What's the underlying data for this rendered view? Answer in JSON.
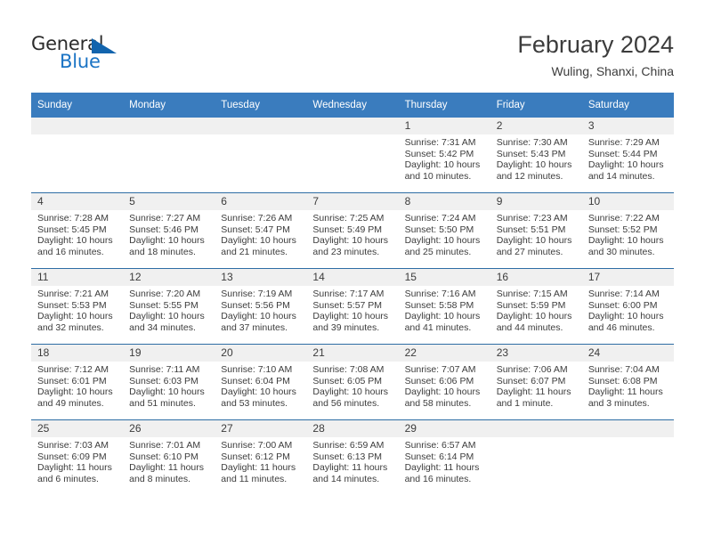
{
  "logo": {
    "text_top": "General",
    "text_bottom": "Blue",
    "triangle_icon": "triangle-icon",
    "color_dark": "#2b2b2b",
    "color_blue": "#1a73c4"
  },
  "header": {
    "title": "February 2024",
    "subtitle": "Wuling, Shanxi, China"
  },
  "theme": {
    "header_blue": "#3a7cbe",
    "rule_blue": "#2e6da4",
    "day_band_gray": "#f0f0f0",
    "text": "#3c3c3c"
  },
  "calendar": {
    "weekday_headers": [
      "Sunday",
      "Monday",
      "Tuesday",
      "Wednesday",
      "Thursday",
      "Friday",
      "Saturday"
    ],
    "weeks": [
      [
        {
          "day": "",
          "sunrise": "",
          "sunset": "",
          "daylight_1": "",
          "daylight_2": ""
        },
        {
          "day": "",
          "sunrise": "",
          "sunset": "",
          "daylight_1": "",
          "daylight_2": ""
        },
        {
          "day": "",
          "sunrise": "",
          "sunset": "",
          "daylight_1": "",
          "daylight_2": ""
        },
        {
          "day": "",
          "sunrise": "",
          "sunset": "",
          "daylight_1": "",
          "daylight_2": ""
        },
        {
          "day": "1",
          "sunrise": "Sunrise: 7:31 AM",
          "sunset": "Sunset: 5:42 PM",
          "daylight_1": "Daylight: 10 hours",
          "daylight_2": "and 10 minutes."
        },
        {
          "day": "2",
          "sunrise": "Sunrise: 7:30 AM",
          "sunset": "Sunset: 5:43 PM",
          "daylight_1": "Daylight: 10 hours",
          "daylight_2": "and 12 minutes."
        },
        {
          "day": "3",
          "sunrise": "Sunrise: 7:29 AM",
          "sunset": "Sunset: 5:44 PM",
          "daylight_1": "Daylight: 10 hours",
          "daylight_2": "and 14 minutes."
        }
      ],
      [
        {
          "day": "4",
          "sunrise": "Sunrise: 7:28 AM",
          "sunset": "Sunset: 5:45 PM",
          "daylight_1": "Daylight: 10 hours",
          "daylight_2": "and 16 minutes."
        },
        {
          "day": "5",
          "sunrise": "Sunrise: 7:27 AM",
          "sunset": "Sunset: 5:46 PM",
          "daylight_1": "Daylight: 10 hours",
          "daylight_2": "and 18 minutes."
        },
        {
          "day": "6",
          "sunrise": "Sunrise: 7:26 AM",
          "sunset": "Sunset: 5:47 PM",
          "daylight_1": "Daylight: 10 hours",
          "daylight_2": "and 21 minutes."
        },
        {
          "day": "7",
          "sunrise": "Sunrise: 7:25 AM",
          "sunset": "Sunset: 5:49 PM",
          "daylight_1": "Daylight: 10 hours",
          "daylight_2": "and 23 minutes."
        },
        {
          "day": "8",
          "sunrise": "Sunrise: 7:24 AM",
          "sunset": "Sunset: 5:50 PM",
          "daylight_1": "Daylight: 10 hours",
          "daylight_2": "and 25 minutes."
        },
        {
          "day": "9",
          "sunrise": "Sunrise: 7:23 AM",
          "sunset": "Sunset: 5:51 PM",
          "daylight_1": "Daylight: 10 hours",
          "daylight_2": "and 27 minutes."
        },
        {
          "day": "10",
          "sunrise": "Sunrise: 7:22 AM",
          "sunset": "Sunset: 5:52 PM",
          "daylight_1": "Daylight: 10 hours",
          "daylight_2": "and 30 minutes."
        }
      ],
      [
        {
          "day": "11",
          "sunrise": "Sunrise: 7:21 AM",
          "sunset": "Sunset: 5:53 PM",
          "daylight_1": "Daylight: 10 hours",
          "daylight_2": "and 32 minutes."
        },
        {
          "day": "12",
          "sunrise": "Sunrise: 7:20 AM",
          "sunset": "Sunset: 5:55 PM",
          "daylight_1": "Daylight: 10 hours",
          "daylight_2": "and 34 minutes."
        },
        {
          "day": "13",
          "sunrise": "Sunrise: 7:19 AM",
          "sunset": "Sunset: 5:56 PM",
          "daylight_1": "Daylight: 10 hours",
          "daylight_2": "and 37 minutes."
        },
        {
          "day": "14",
          "sunrise": "Sunrise: 7:17 AM",
          "sunset": "Sunset: 5:57 PM",
          "daylight_1": "Daylight: 10 hours",
          "daylight_2": "and 39 minutes."
        },
        {
          "day": "15",
          "sunrise": "Sunrise: 7:16 AM",
          "sunset": "Sunset: 5:58 PM",
          "daylight_1": "Daylight: 10 hours",
          "daylight_2": "and 41 minutes."
        },
        {
          "day": "16",
          "sunrise": "Sunrise: 7:15 AM",
          "sunset": "Sunset: 5:59 PM",
          "daylight_1": "Daylight: 10 hours",
          "daylight_2": "and 44 minutes."
        },
        {
          "day": "17",
          "sunrise": "Sunrise: 7:14 AM",
          "sunset": "Sunset: 6:00 PM",
          "daylight_1": "Daylight: 10 hours",
          "daylight_2": "and 46 minutes."
        }
      ],
      [
        {
          "day": "18",
          "sunrise": "Sunrise: 7:12 AM",
          "sunset": "Sunset: 6:01 PM",
          "daylight_1": "Daylight: 10 hours",
          "daylight_2": "and 49 minutes."
        },
        {
          "day": "19",
          "sunrise": "Sunrise: 7:11 AM",
          "sunset": "Sunset: 6:03 PM",
          "daylight_1": "Daylight: 10 hours",
          "daylight_2": "and 51 minutes."
        },
        {
          "day": "20",
          "sunrise": "Sunrise: 7:10 AM",
          "sunset": "Sunset: 6:04 PM",
          "daylight_1": "Daylight: 10 hours",
          "daylight_2": "and 53 minutes."
        },
        {
          "day": "21",
          "sunrise": "Sunrise: 7:08 AM",
          "sunset": "Sunset: 6:05 PM",
          "daylight_1": "Daylight: 10 hours",
          "daylight_2": "and 56 minutes."
        },
        {
          "day": "22",
          "sunrise": "Sunrise: 7:07 AM",
          "sunset": "Sunset: 6:06 PM",
          "daylight_1": "Daylight: 10 hours",
          "daylight_2": "and 58 minutes."
        },
        {
          "day": "23",
          "sunrise": "Sunrise: 7:06 AM",
          "sunset": "Sunset: 6:07 PM",
          "daylight_1": "Daylight: 11 hours",
          "daylight_2": "and 1 minute."
        },
        {
          "day": "24",
          "sunrise": "Sunrise: 7:04 AM",
          "sunset": "Sunset: 6:08 PM",
          "daylight_1": "Daylight: 11 hours",
          "daylight_2": "and 3 minutes."
        }
      ],
      [
        {
          "day": "25",
          "sunrise": "Sunrise: 7:03 AM",
          "sunset": "Sunset: 6:09 PM",
          "daylight_1": "Daylight: 11 hours",
          "daylight_2": "and 6 minutes."
        },
        {
          "day": "26",
          "sunrise": "Sunrise: 7:01 AM",
          "sunset": "Sunset: 6:10 PM",
          "daylight_1": "Daylight: 11 hours",
          "daylight_2": "and 8 minutes."
        },
        {
          "day": "27",
          "sunrise": "Sunrise: 7:00 AM",
          "sunset": "Sunset: 6:12 PM",
          "daylight_1": "Daylight: 11 hours",
          "daylight_2": "and 11 minutes."
        },
        {
          "day": "28",
          "sunrise": "Sunrise: 6:59 AM",
          "sunset": "Sunset: 6:13 PM",
          "daylight_1": "Daylight: 11 hours",
          "daylight_2": "and 14 minutes."
        },
        {
          "day": "29",
          "sunrise": "Sunrise: 6:57 AM",
          "sunset": "Sunset: 6:14 PM",
          "daylight_1": "Daylight: 11 hours",
          "daylight_2": "and 16 minutes."
        },
        {
          "day": "",
          "sunrise": "",
          "sunset": "",
          "daylight_1": "",
          "daylight_2": ""
        },
        {
          "day": "",
          "sunrise": "",
          "sunset": "",
          "daylight_1": "",
          "daylight_2": ""
        }
      ]
    ]
  }
}
